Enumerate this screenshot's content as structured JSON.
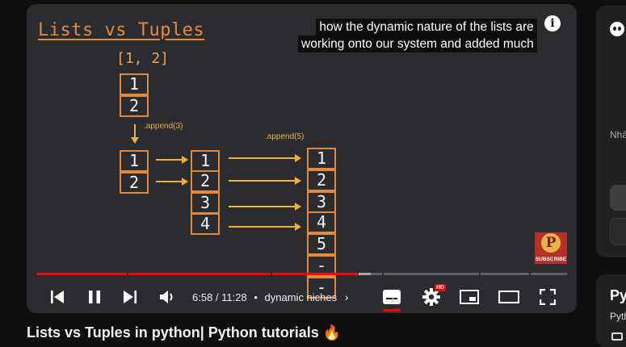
{
  "slide": {
    "title": "Lists vs Tuples",
    "list_literal": "[1, 2]",
    "initial_list": [
      "1",
      "2"
    ],
    "append_label_1": ".append(3)",
    "middle_list": [
      "1",
      "2",
      "3",
      "4"
    ],
    "append_label_2": ".append(5)",
    "final_list": [
      "1",
      "2",
      "3",
      "4",
      "5",
      "-",
      "-"
    ]
  },
  "caption": {
    "line1": "how the dynamic nature of the lists are",
    "line2": "working onto our system and added much"
  },
  "watermark": {
    "letter": "P",
    "label": "SUBSCRIBE"
  },
  "player": {
    "current_time": "6:58",
    "duration": "11:28",
    "time_display": "6:58 / 11:28",
    "chapter": "dynamic niches",
    "progress_fraction": 0.608,
    "buffer_fraction": 0.63,
    "hd_badge": "HD",
    "accent_color": "#ff0000"
  },
  "controls": {
    "icons": [
      "previous-icon",
      "pause-icon",
      "next-icon",
      "volume-icon",
      "subtitles-icon",
      "settings-icon",
      "miniplayer-icon",
      "theater-icon",
      "fullscreen-icon"
    ]
  },
  "video": {
    "title": "Lists vs Tuples in python| Python tutorials 🔥"
  },
  "sidebar": {
    "text": "Nhấ",
    "card2_title": "Py",
    "card2_sub": "Pyth"
  }
}
